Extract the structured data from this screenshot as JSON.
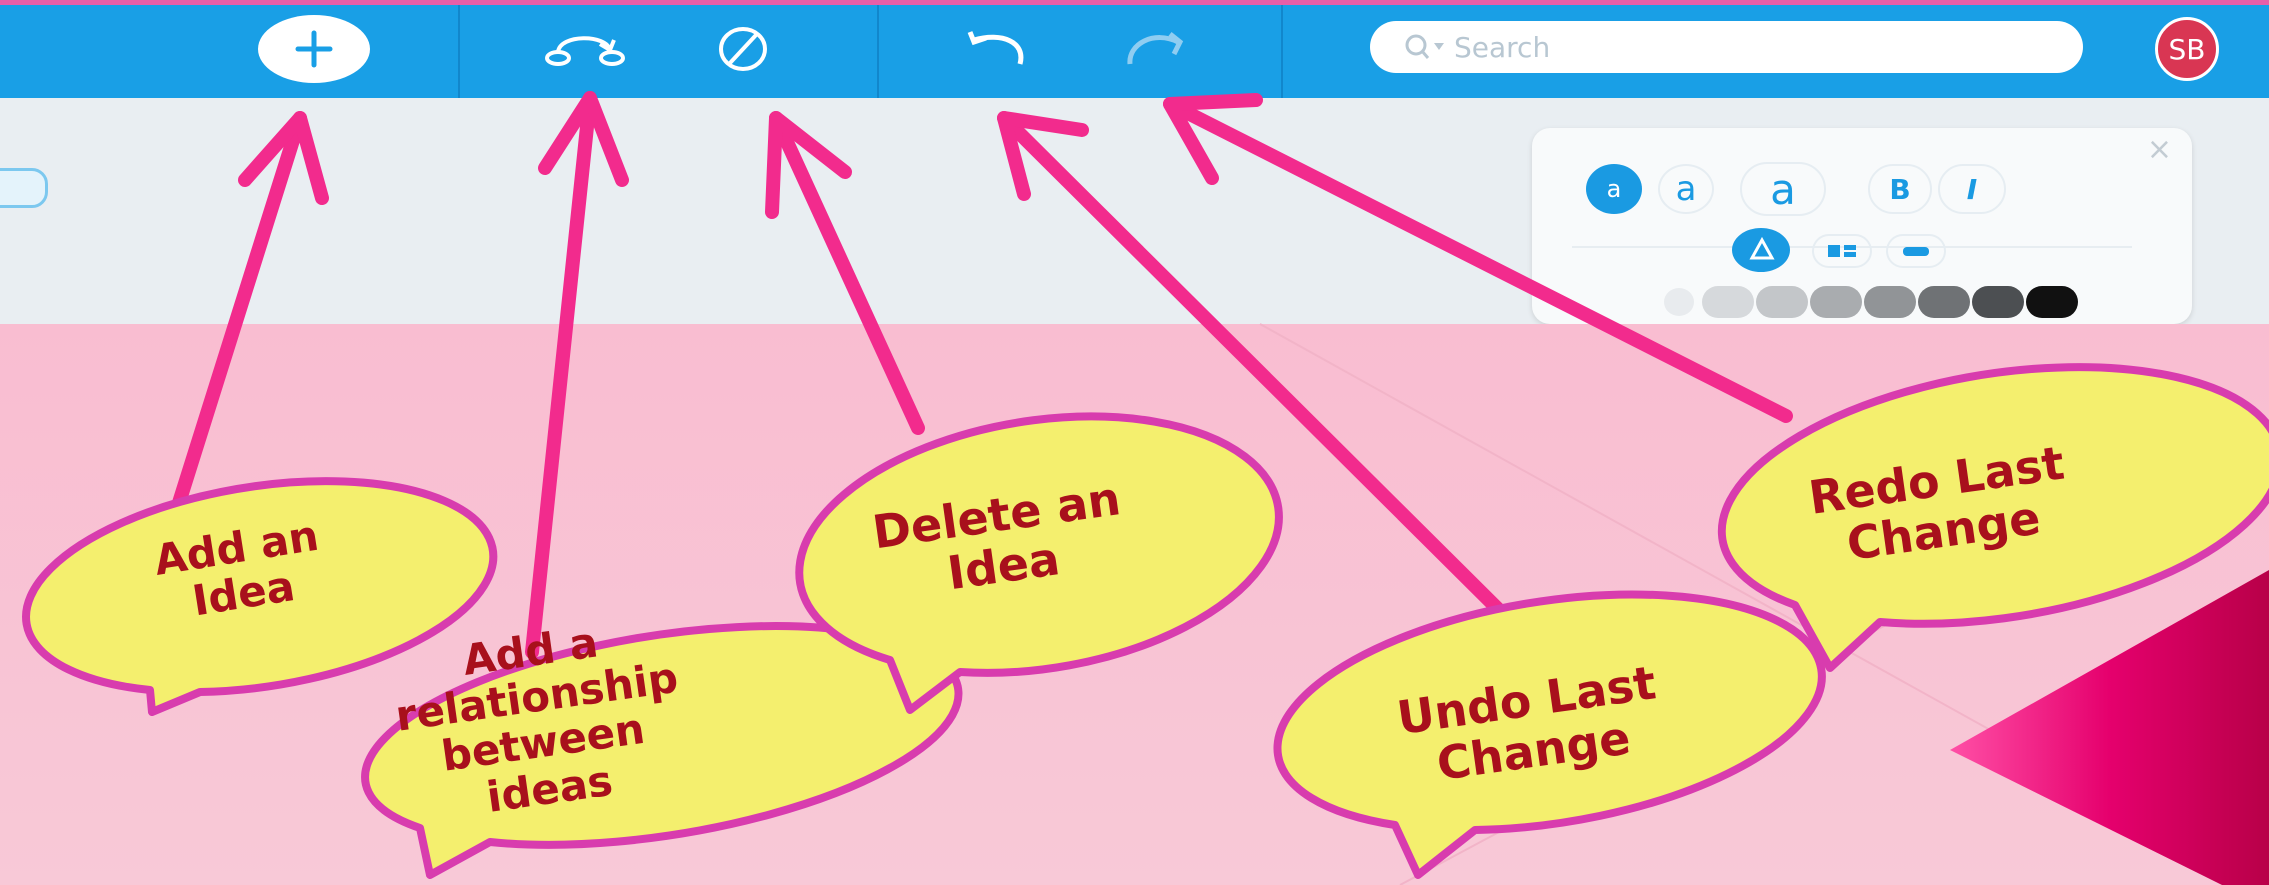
{
  "toolbar": {
    "search_placeholder": "Search",
    "avatar_initials": "SB"
  },
  "format_panel": {
    "font_sizes": [
      "a",
      "a",
      "a"
    ],
    "bold_label": "B",
    "italic_label": "I",
    "close_glyph": "×"
  },
  "callouts": {
    "add_idea": [
      "Add an",
      "Idea"
    ],
    "add_relationship": [
      "Add a",
      "relationship",
      "between",
      "ideas"
    ],
    "delete_idea": [
      "Delete an",
      "Idea"
    ],
    "undo": [
      "Undo Last",
      "Change"
    ],
    "redo": [
      "Redo Last",
      "Change"
    ]
  },
  "colors": {
    "toolbar": "#199fe6",
    "arrow": "#f22b8d",
    "bubble_fill": "#f4ef6e",
    "bubble_border": "#d83cae",
    "callout_text": "#a8101c"
  },
  "icons": [
    "add-idea-icon",
    "add-relationship-icon",
    "delete-idea-icon",
    "undo-icon",
    "redo-icon",
    "search-icon"
  ]
}
